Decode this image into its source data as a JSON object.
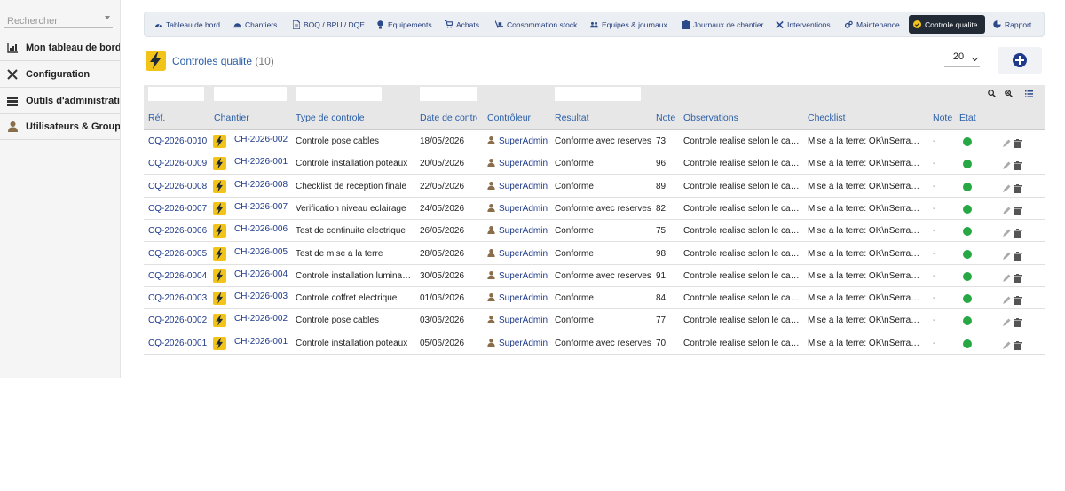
{
  "sidebar": {
    "search_placeholder": "Rechercher",
    "items": [
      {
        "label": "Mon tableau de bord",
        "icon": "chart-icon"
      },
      {
        "label": "Configuration",
        "icon": "tools-icon"
      },
      {
        "label": "Outils d'administration",
        "icon": "server-icon"
      },
      {
        "label": "Utilisateurs & Groupes",
        "icon": "user-icon"
      }
    ]
  },
  "nav": {
    "items": [
      {
        "label": "Tableau de bord",
        "icon": "dashboard-icon"
      },
      {
        "label": "Chantiers",
        "icon": "helmet-icon"
      },
      {
        "label": "BOQ / BPU / DQE",
        "icon": "document-icon"
      },
      {
        "label": "Equipements",
        "icon": "bulb-icon"
      },
      {
        "label": "Achats",
        "icon": "cart-icon"
      },
      {
        "label": "Consommation stock",
        "icon": "dolly-icon"
      },
      {
        "label": "Equipes & journaux",
        "icon": "users-icon"
      },
      {
        "label": "Journaux de chantier",
        "icon": "clipboard-icon"
      },
      {
        "label": "Interventions",
        "icon": "wrench-icon"
      },
      {
        "label": "Maintenance",
        "icon": "cogs-icon"
      },
      {
        "label": "Controle qualite",
        "icon": "check-circle-icon",
        "active": true
      },
      {
        "label": "Rapport",
        "icon": "pie-chart-icon"
      }
    ]
  },
  "page": {
    "title": "Controles qualite",
    "count": "(10)",
    "limit": "20"
  },
  "table": {
    "headers": [
      "Réf.",
      "Chantier",
      "Type de controle",
      "Date de controle",
      "Contrôleur",
      "Resultat",
      "Note",
      "Observations",
      "Checklist",
      "Note",
      "État"
    ],
    "rows": [
      {
        "ref": "CQ-2026-0010",
        "chantier": "CH-2026-002",
        "type": "Controle pose cables",
        "date": "18/05/2026",
        "controleur": "SuperAdmin",
        "resultat": "Conforme avec reserves",
        "note": "73",
        "observations": "Controle realise selon le cahier des charges",
        "checklist": "Mise a la terre: OK\\nSerrage: OK",
        "note2": "-"
      },
      {
        "ref": "CQ-2026-0009",
        "chantier": "CH-2026-001",
        "type": "Controle installation poteaux",
        "date": "20/05/2026",
        "controleur": "SuperAdmin",
        "resultat": "Conforme",
        "note": "96",
        "observations": "Controle realise selon le cahier des charges",
        "checklist": "Mise a la terre: OK\\nSerrage: OK",
        "note2": "-"
      },
      {
        "ref": "CQ-2026-0008",
        "chantier": "CH-2026-008",
        "type": "Checklist de reception finale",
        "date": "22/05/2026",
        "controleur": "SuperAdmin",
        "resultat": "Conforme",
        "note": "89",
        "observations": "Controle realise selon le cahier des charges",
        "checklist": "Mise a la terre: OK\\nSerrage: OK",
        "note2": "-"
      },
      {
        "ref": "CQ-2026-0007",
        "chantier": "CH-2026-007",
        "type": "Verification niveau eclairage",
        "date": "24/05/2026",
        "controleur": "SuperAdmin",
        "resultat": "Conforme avec reserves",
        "note": "82",
        "observations": "Controle realise selon le cahier des charges",
        "checklist": "Mise a la terre: OK\\nSerrage: OK",
        "note2": "-"
      },
      {
        "ref": "CQ-2026-0006",
        "chantier": "CH-2026-006",
        "type": "Test de continuite electrique",
        "date": "26/05/2026",
        "controleur": "SuperAdmin",
        "resultat": "Conforme",
        "note": "75",
        "observations": "Controle realise selon le cahier des charges",
        "checklist": "Mise a la terre: OK\\nSerrage: OK",
        "note2": "-"
      },
      {
        "ref": "CQ-2026-0005",
        "chantier": "CH-2026-005",
        "type": "Test de mise a la terre",
        "date": "28/05/2026",
        "controleur": "SuperAdmin",
        "resultat": "Conforme",
        "note": "98",
        "observations": "Controle realise selon le cahier des charges",
        "checklist": "Mise a la terre: OK\\nSerrage: OK",
        "note2": "-"
      },
      {
        "ref": "CQ-2026-0004",
        "chantier": "CH-2026-004",
        "type": "Controle installation luminaires",
        "date": "30/05/2026",
        "controleur": "SuperAdmin",
        "resultat": "Conforme avec reserves",
        "note": "91",
        "observations": "Controle realise selon le cahier des charges",
        "checklist": "Mise a la terre: OK\\nSerrage: OK",
        "note2": "-"
      },
      {
        "ref": "CQ-2026-0003",
        "chantier": "CH-2026-003",
        "type": "Controle coffret electrique",
        "date": "01/06/2026",
        "controleur": "SuperAdmin",
        "resultat": "Conforme",
        "note": "84",
        "observations": "Controle realise selon le cahier des charges",
        "checklist": "Mise a la terre: OK\\nSerrage: OK",
        "note2": "-"
      },
      {
        "ref": "CQ-2026-0002",
        "chantier": "CH-2026-002",
        "type": "Controle pose cables",
        "date": "03/06/2026",
        "controleur": "SuperAdmin",
        "resultat": "Conforme",
        "note": "77",
        "observations": "Controle realise selon le cahier des charges",
        "checklist": "Mise a la terre: OK\\nSerrage: OK",
        "note2": "-"
      },
      {
        "ref": "CQ-2026-0001",
        "chantier": "CH-2026-001",
        "type": "Controle installation poteaux",
        "date": "05/06/2026",
        "controleur": "SuperAdmin",
        "resultat": "Conforme avec reserves",
        "note": "70",
        "observations": "Controle realise selon le cahier des charges",
        "checklist": "Mise a la terre: OK\\nSerrage: OK",
        "note2": "-"
      }
    ]
  },
  "colors": {
    "accent": "#1f3a8a",
    "link": "#2a5ea7",
    "active_nav": "#222b35",
    "status_ok": "#28a745"
  }
}
